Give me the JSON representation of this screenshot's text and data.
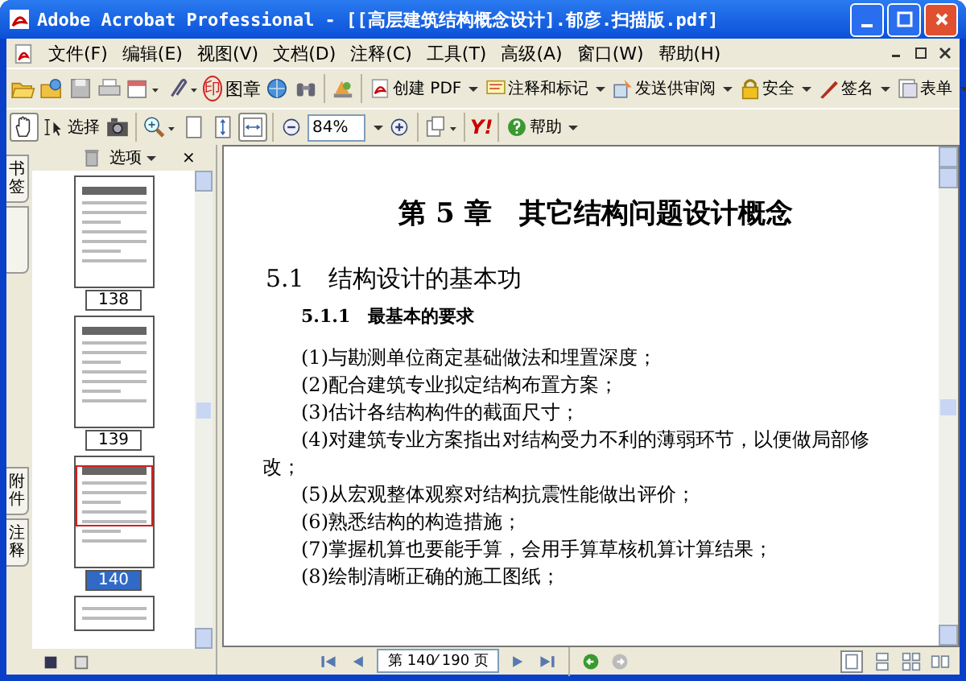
{
  "window": {
    "title": "Adobe Acrobat Professional - [[高层建筑结构概念设计].郁彦.扫描版.pdf]"
  },
  "menu": [
    "文件(F)",
    "编辑(E)",
    "视图(V)",
    "文档(D)",
    "注释(C)",
    "工具(T)",
    "高级(A)",
    "窗口(W)",
    "帮助(H)"
  ],
  "toolbar1": {
    "stamp_glyph": "印",
    "stamp_label": "图章",
    "tasks": [
      {
        "kind": "pdf",
        "label": "创建 PDF"
      },
      {
        "kind": "comment",
        "label": "注释和标记"
      },
      {
        "kind": "review",
        "label": "发送供审阅"
      },
      {
        "kind": "lock",
        "label": "安全"
      },
      {
        "kind": "pen",
        "label": "签名"
      },
      {
        "kind": "form",
        "label": "表单"
      }
    ]
  },
  "toolbar2": {
    "hand_selected": true,
    "select_label": "选择",
    "zoom_value": "84%",
    "fit_selected": true,
    "yahoo_label": "Y!",
    "help_label": "帮助"
  },
  "sidebar": {
    "tabs": [
      {
        "label": "书签"
      },
      {
        "label": "附件"
      },
      {
        "label": "注释"
      }
    ],
    "options_label": "选项",
    "close_label": "×",
    "thumbnails": [
      {
        "page": "138",
        "selected": false
      },
      {
        "page": "139",
        "selected": false
      },
      {
        "page": "140",
        "selected": true
      }
    ]
  },
  "document": {
    "chapter_title": "第 5 章　其它结构问题设计概念",
    "section_title": "5.1　结构设计的基本功",
    "subsection_title": "5.1.1　最基本的要求",
    "paragraphs": [
      "(1)与勘测单位商定基础做法和埋置深度；",
      "(2)配合建筑专业拟定结构布置方案；",
      "(3)估计各结构构件的截面尺寸；",
      "(4)对建筑专业方案指出对结构受力不利的薄弱环节，以便做局部修改；",
      "(5)从宏观整体观察对结构抗震性能做出评价；",
      "(6)熟悉结构的构造措施；",
      "(7)掌握机算也要能手算，会用手算草核机算计算结果；",
      "(8)绘制清晰正确的施工图纸；"
    ]
  },
  "status_bar": {
    "page_field": "第 140⁄ 190 页"
  }
}
